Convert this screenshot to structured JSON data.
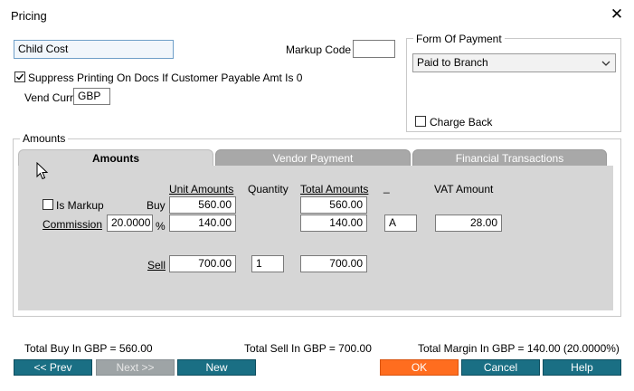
{
  "window": {
    "title": "Pricing",
    "close_glyph": "✕"
  },
  "top": {
    "cost_name": "Child Cost",
    "markup_code_label": "Markup Code",
    "markup_code_value": "",
    "suppress_label": "Suppress Printing On Docs If Customer Payable Amt Is 0",
    "suppress_checked": true,
    "vend_curr_label": "Vend Curr",
    "vend_curr_value": "GBP"
  },
  "form_of_payment": {
    "label": "Form Of Payment",
    "selected": "Paid to Branch",
    "charge_back_label": "Charge Back",
    "charge_back_checked": false
  },
  "amounts_group": {
    "label": "Amounts",
    "tabs": [
      "Amounts",
      "Vendor Payment",
      "Financial Transactions"
    ],
    "active_tab": 0,
    "headers": {
      "unit_amounts": "Unit Amounts",
      "quantity": "Quantity",
      "total_amounts": "Total Amounts",
      "code": "_",
      "vat_amount": "VAT Amount"
    },
    "is_markup_label": "Is Markup",
    "is_markup_checked": false,
    "buy_label": "Buy",
    "buy_unit": "560.00",
    "buy_total": "560.00",
    "commission_label": "Commission",
    "commission_pct": "20.0000",
    "pct_sign": "%",
    "commission_unit": "140.00",
    "commission_total": "140.00",
    "commission_code": "A",
    "commission_vat": "28.00",
    "sell_label": "Sell",
    "sell_unit": "700.00",
    "sell_qty": "1",
    "sell_total": "700.00"
  },
  "totals": {
    "total_buy": "Total Buy In GBP = 560.00",
    "total_sell": "Total Sell In GBP = 700.00",
    "total_margin": "Total Margin In GBP = 140.00 (20.0000%)"
  },
  "buttons": {
    "prev": "<< Prev",
    "next": "Next >>",
    "new": "New",
    "ok": "OK",
    "cancel": "Cancel",
    "help": "Help"
  },
  "colors": {
    "button_teal": "#1a6f84",
    "ok_orange": "#ff6d1f",
    "panel_gray": "#d6d6d6"
  }
}
